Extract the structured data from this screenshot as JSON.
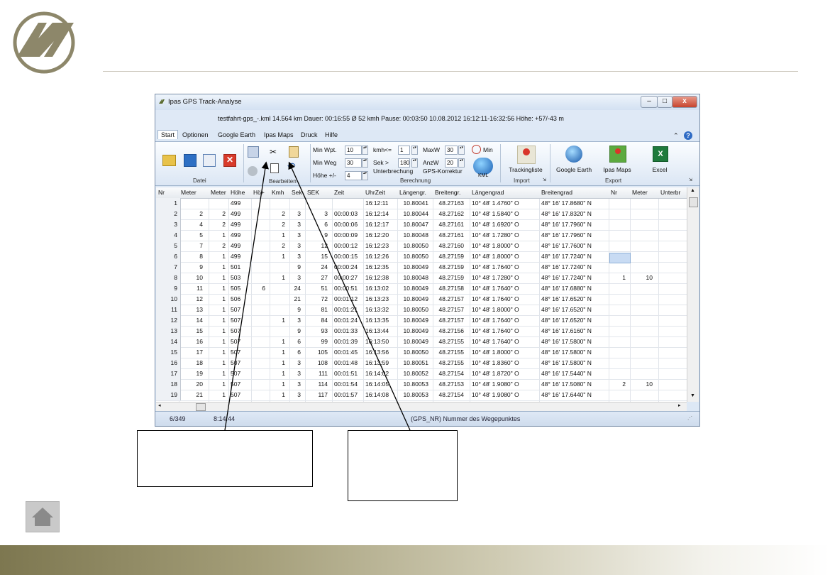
{
  "window": {
    "title": "Ipas GPS Track-Analyse",
    "info": "testfahrt-gps_-.kml  14.564 km  Dauer: 00:16:55  Ø 52 kmh  Pause: 00:03:50  10.08.2012 16:12:11-16:32:56   Höhe: +57/-43 m",
    "controls": {
      "minimize": "–",
      "maximize": "□",
      "close": "x"
    }
  },
  "tabs": [
    "Start",
    "Optionen",
    "Google Earth",
    "Ipas Maps",
    "Druck",
    "Hilfe"
  ],
  "ribbon": {
    "groups": {
      "datei": "Datei",
      "bearbeiten": "Bearbeiten",
      "berechnung": "Berechnung",
      "import": "Import",
      "export": "Export"
    },
    "fields": {
      "min_wpt_label": "Min Wpt.",
      "min_wpt": "10",
      "min_weg_label": "Min Weg",
      "min_weg": "30",
      "hoehe_label": "Höhe +/-",
      "hoehe": "4",
      "kmh_label": "kmh<=",
      "kmh": "1",
      "sek_label": "Sek >",
      "sek": "180",
      "unterbrechung_label": "Unterbrechung",
      "maxw_label": "MaxW",
      "maxw": "30",
      "anzw_label": "AnzW",
      "anzw": "20",
      "gps_label": "GPS-Korrektur",
      "min_label": "Min",
      "kml_label": "KML"
    },
    "buttons": {
      "trackingliste": "Trackingliste",
      "google_earth": "Google Earth",
      "ipas_maps": "Ipas Maps",
      "excel": "Excel"
    }
  },
  "grid": {
    "headers": [
      "Nr",
      "Meter",
      "Meter",
      "Höhe",
      "Hö+",
      "Kmh",
      "Sek",
      "SEK",
      "Zeit",
      "UhrZeit",
      "Längengr.",
      "Breitengr.",
      "Längengrad",
      "Breitengrad",
      "Nr",
      "Meter",
      "Unterbr"
    ],
    "rows": [
      [
        "1",
        "",
        "",
        "499",
        "",
        "",
        "",
        "",
        "",
        "16:12:11",
        "10.80041",
        "48.27163",
        "10° 48' 1.4760\" O",
        "48° 16' 17.8680\" N",
        "",
        ""
      ],
      [
        "2",
        "2",
        "2",
        "499",
        "",
        "2",
        "3",
        "3",
        "00:00:03",
        "16:12:14",
        "10.80044",
        "48.27162",
        "10° 48' 1.5840\" O",
        "48° 16' 17.8320\" N",
        "",
        ""
      ],
      [
        "3",
        "4",
        "2",
        "499",
        "",
        "2",
        "3",
        "6",
        "00:00:06",
        "16:12:17",
        "10.80047",
        "48.27161",
        "10° 48' 1.6920\" O",
        "48° 16' 17.7960\" N",
        "",
        ""
      ],
      [
        "4",
        "5",
        "1",
        "499",
        "",
        "1",
        "3",
        "9",
        "00:00:09",
        "16:12:20",
        "10.80048",
        "48.27161",
        "10° 48' 1.7280\" O",
        "48° 16' 17.7960\" N",
        "",
        ""
      ],
      [
        "5",
        "7",
        "2",
        "499",
        "",
        "2",
        "3",
        "12",
        "00:00:12",
        "16:12:23",
        "10.80050",
        "48.27160",
        "10° 48' 1.8000\" O",
        "48° 16' 17.7600\" N",
        "",
        ""
      ],
      [
        "6",
        "8",
        "1",
        "499",
        "",
        "1",
        "3",
        "15",
        "00:00:15",
        "16:12:26",
        "10.80050",
        "48.27159",
        "10° 48' 1.8000\" O",
        "48° 16' 17.7240\" N",
        "",
        ""
      ],
      [
        "7",
        "9",
        "1",
        "501",
        "",
        "",
        "9",
        "24",
        "00:00:24",
        "16:12:35",
        "10.80049",
        "48.27159",
        "10° 48' 1.7640\" O",
        "48° 16' 17.7240\" N",
        "",
        ""
      ],
      [
        "8",
        "10",
        "1",
        "503",
        "",
        "1",
        "3",
        "27",
        "00:00:27",
        "16:12:38",
        "10.80048",
        "48.27159",
        "10° 48' 1.7280\" O",
        "48° 16' 17.7240\" N",
        "1",
        "10"
      ],
      [
        "9",
        "11",
        "1",
        "505",
        "6",
        "",
        "24",
        "51",
        "00:00:51",
        "16:13:02",
        "10.80049",
        "48.27158",
        "10° 48' 1.7640\" O",
        "48° 16' 17.6880\" N",
        "",
        ""
      ],
      [
        "10",
        "12",
        "1",
        "506",
        "",
        "",
        "21",
        "72",
        "00:01:12",
        "16:13:23",
        "10.80049",
        "48.27157",
        "10° 48' 1.7640\" O",
        "48° 16' 17.6520\" N",
        "",
        ""
      ],
      [
        "11",
        "13",
        "1",
        "507",
        "",
        "",
        "9",
        "81",
        "00:01:21",
        "16:13:32",
        "10.80050",
        "48.27157",
        "10° 48' 1.8000\" O",
        "48° 16' 17.6520\" N",
        "",
        ""
      ],
      [
        "12",
        "14",
        "1",
        "507",
        "",
        "1",
        "3",
        "84",
        "00:01:24",
        "16:13:35",
        "10.80049",
        "48.27157",
        "10° 48' 1.7640\" O",
        "48° 16' 17.6520\" N",
        "",
        ""
      ],
      [
        "13",
        "15",
        "1",
        "507",
        "",
        "",
        "9",
        "93",
        "00:01:33",
        "16:13:44",
        "10.80049",
        "48.27156",
        "10° 48' 1.7640\" O",
        "48° 16' 17.6160\" N",
        "",
        ""
      ],
      [
        "14",
        "16",
        "1",
        "507",
        "",
        "1",
        "6",
        "99",
        "00:01:39",
        "16:13:50",
        "10.80049",
        "48.27155",
        "10° 48' 1.7640\" O",
        "48° 16' 17.5800\" N",
        "",
        ""
      ],
      [
        "15",
        "17",
        "1",
        "507",
        "",
        "1",
        "6",
        "105",
        "00:01:45",
        "16:13:56",
        "10.80050",
        "48.27155",
        "10° 48' 1.8000\" O",
        "48° 16' 17.5800\" N",
        "",
        ""
      ],
      [
        "16",
        "18",
        "1",
        "507",
        "",
        "1",
        "3",
        "108",
        "00:01:48",
        "16:13:59",
        "10.80051",
        "48.27155",
        "10° 48' 1.8360\" O",
        "48° 16' 17.5800\" N",
        "",
        ""
      ],
      [
        "17",
        "19",
        "1",
        "507",
        "",
        "1",
        "3",
        "111",
        "00:01:51",
        "16:14:02",
        "10.80052",
        "48.27154",
        "10° 48' 1.8720\" O",
        "48° 16' 17.5440\" N",
        "",
        ""
      ],
      [
        "18",
        "20",
        "1",
        "507",
        "",
        "1",
        "3",
        "114",
        "00:01:54",
        "16:14:05",
        "10.80053",
        "48.27153",
        "10° 48' 1.9080\" O",
        "48° 16' 17.5080\" N",
        "2",
        "10"
      ],
      [
        "19",
        "21",
        "1",
        "507",
        "",
        "1",
        "3",
        "117",
        "00:01:57",
        "16:14:08",
        "10.80053",
        "48.27154",
        "10° 48' 1.9080\" O",
        "48° 16' 17.6440\" N",
        "",
        ""
      ]
    ]
  },
  "status": {
    "position": "6/349",
    "time": "8:14:44",
    "hint": "(GPS_NR)  Nummer des Wegepunktes"
  },
  "colors": {
    "highlight": "#e01818",
    "olive": "#7d7750"
  }
}
